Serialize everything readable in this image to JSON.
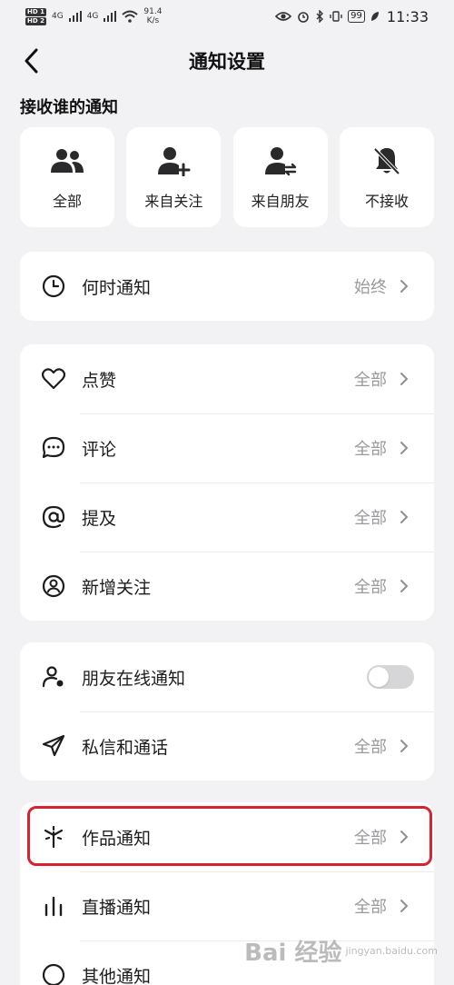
{
  "status_bar": {
    "hd1": "HD 1",
    "hd2": "HD 2",
    "net1": "4G",
    "net2": "4G",
    "speed": "91.4",
    "speed_unit": "K/s",
    "battery": "99",
    "time": "11:33"
  },
  "header": {
    "title": "通知设置"
  },
  "receive_section": {
    "title": "接收谁的通知",
    "options": [
      {
        "label": "全部",
        "icon": "group-icon"
      },
      {
        "label": "来自关注",
        "icon": "add-person-icon"
      },
      {
        "label": "来自朋友",
        "icon": "friend-swap-icon"
      },
      {
        "label": "不接收",
        "icon": "bell-off-icon"
      }
    ]
  },
  "when_card": {
    "label": "何时通知",
    "value": "始终",
    "icon": "clock-icon"
  },
  "interaction_card": {
    "rows": [
      {
        "label": "点赞",
        "value": "全部",
        "icon": "heart-icon"
      },
      {
        "label": "评论",
        "value": "全部",
        "icon": "comment-icon"
      },
      {
        "label": "提及",
        "value": "全部",
        "icon": "at-icon"
      },
      {
        "label": "新增关注",
        "value": "全部",
        "icon": "person-circle-icon"
      }
    ]
  },
  "social_card": {
    "online": {
      "label": "朋友在线通知",
      "icon": "person-online-icon",
      "enabled": false
    },
    "messages": {
      "label": "私信和通话",
      "value": "全部",
      "icon": "send-icon"
    }
  },
  "content_card": {
    "rows": [
      {
        "label": "作品通知",
        "value": "全部",
        "icon": "sparkle-icon"
      },
      {
        "label": "直播通知",
        "value": "全部",
        "icon": "bars-icon"
      },
      {
        "label": "其他通知",
        "value": "",
        "icon": "other-icon"
      }
    ]
  },
  "watermark": {
    "text": "Bai 经验",
    "sub": "jingyan.baidu.com"
  },
  "colors": {
    "background": "#f2f2f4",
    "card": "#ffffff",
    "highlight": "#d5232f",
    "value_gray": "#9a9a9e"
  }
}
